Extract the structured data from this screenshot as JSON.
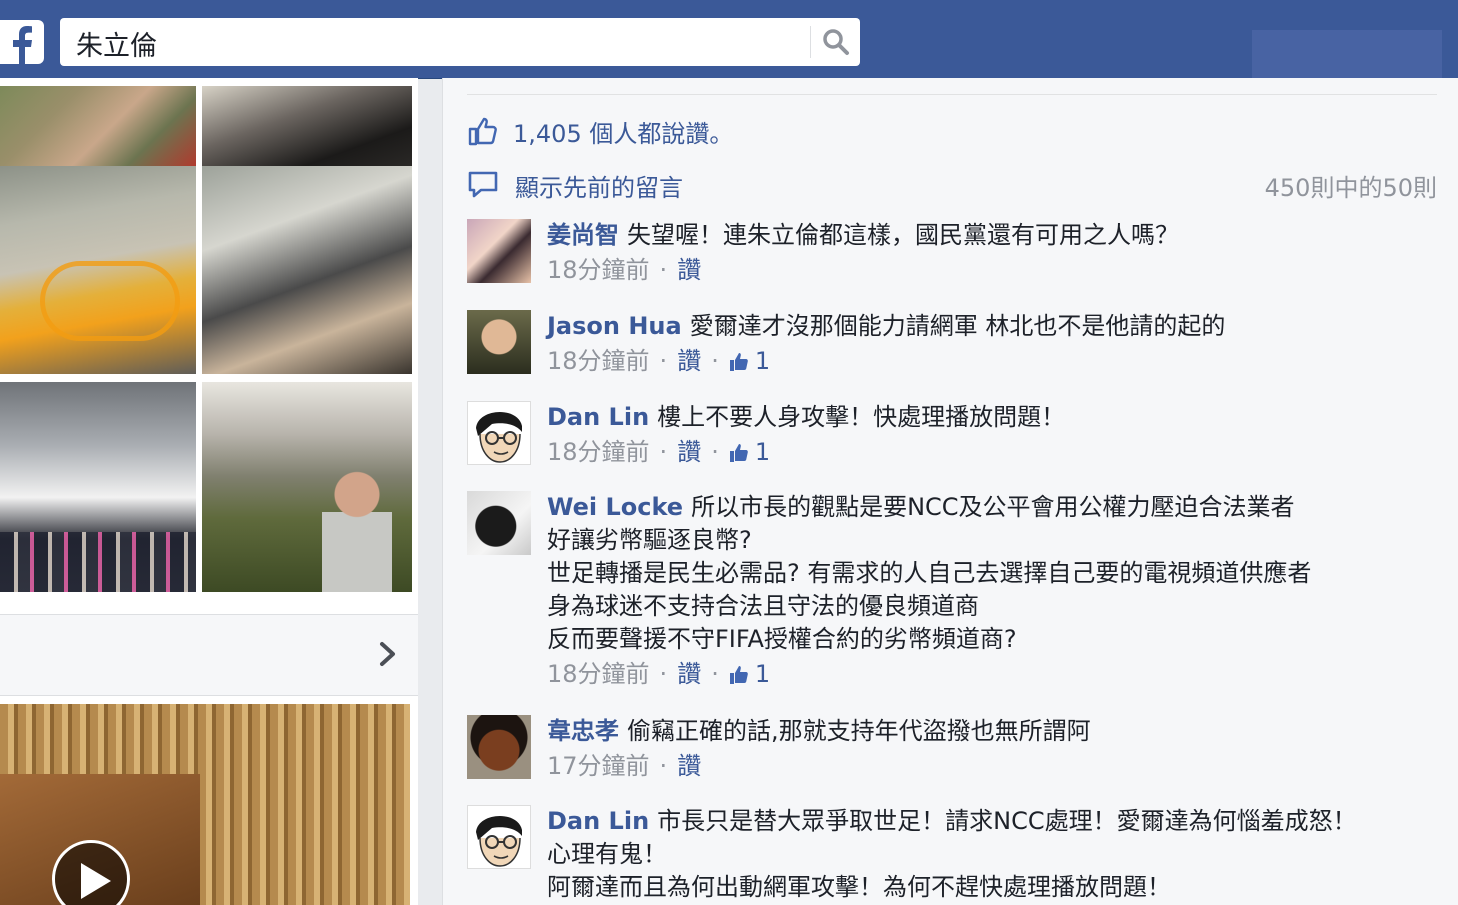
{
  "search": {
    "query": "朱立倫",
    "logo_icon": "facebook-f-icon",
    "button_icon": "search-icon"
  },
  "colors": {
    "topbar": "#3b5998",
    "link": "#3b5998",
    "meta": "#90949c",
    "text": "#1d2129"
  },
  "left_panel": {
    "photos": [
      "soldiers-photo",
      "train-interior-photo",
      "bicycle-rack-photo",
      "train-passengers-photo",
      "group-ceremony-photo",
      "tea-field-photo"
    ],
    "more_icon": "chevron-right-icon",
    "video_icon": "play-icon"
  },
  "comments_panel": {
    "likes_text": "1,405 個人都說讚。",
    "view_previous": "顯示先前的留言",
    "count_text": "450則中的50則",
    "comments": [
      {
        "author": "姜尚智",
        "text": "失望喔！連朱立倫都這樣，國民黨還有可用之人嗎？",
        "time": "18分鐘前",
        "like_label": "讚",
        "likes": ""
      },
      {
        "author": "Jason Hua",
        "text": "愛爾達才沒那個能力請網軍 林北也不是他請的起的",
        "time": "18分鐘前",
        "like_label": "讚",
        "likes": "1"
      },
      {
        "author": "Dan Lin",
        "text": "樓上不要人身攻擊！快處理播放問題！",
        "time": "18分鐘前",
        "like_label": "讚",
        "likes": "1"
      },
      {
        "author": "Wei Locke",
        "text": "所以市長的觀點是要NCC及公平會用公權力壓迫合法業者\n好讓劣幣驅逐良幣?\n世足轉播是民生必需品? 有需求的人自己去選擇自己要的電視頻道供應者\n身為球迷不支持合法且守法的優良頻道商\n反而要聲援不守FIFA授權合約的劣幣頻道商?",
        "time": "18分鐘前",
        "like_label": "讚",
        "likes": "1"
      },
      {
        "author": "韋忠孝",
        "text": "偷竊正確的話,那就支持年代盜撥也無所謂阿",
        "time": "17分鐘前",
        "like_label": "讚",
        "likes": ""
      },
      {
        "author": "Dan Lin",
        "text": "市長只是替大眾爭取世足！請求NCC處理！愛爾達為何惱羞成怒！\n心理有鬼！\n阿爾達而且為何出動網軍攻擊！為何不趕快處理播放問題！",
        "time": "",
        "like_label": "",
        "likes": ""
      }
    ]
  }
}
